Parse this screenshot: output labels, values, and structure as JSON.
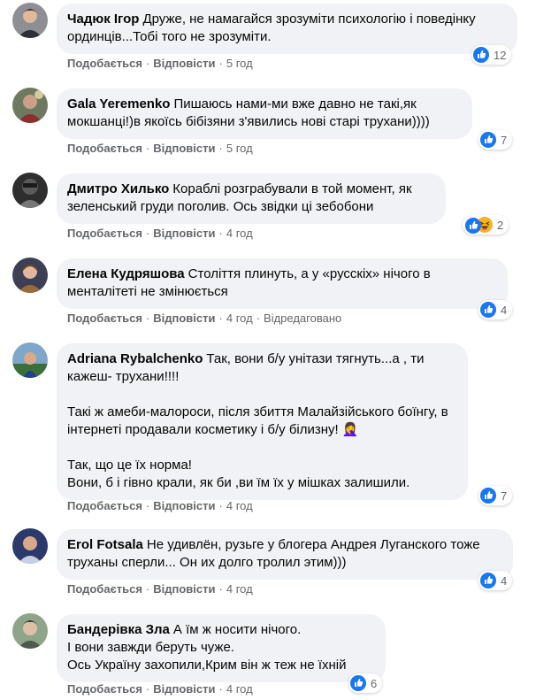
{
  "labels": {
    "like": "Подобається",
    "reply": "Відповісти",
    "dot": "·"
  },
  "colors": {
    "bubble": "#f0f2f5",
    "like_blue": "#1877f2",
    "haha_yellow": "#f7b125",
    "meta_gray": "#65676b"
  },
  "comments": [
    {
      "author": "Чадюк Ігор",
      "text": "Друже, не намагайся зрозуміти психологію і поведінку ординців...Тобі того не зрозуміти.",
      "time": "5 год",
      "reaction_count": "12",
      "reaction_icons": [
        "like-icon"
      ]
    },
    {
      "author": "Gala Yeremenko",
      "text": "Пишаюсь нами-ми вже давно не такі,як мокшанці!)в якоїсь бібізяни з'явились нові старі трухани))))",
      "time": "5 год",
      "reaction_count": "7",
      "reaction_icons": [
        "like-icon"
      ]
    },
    {
      "author": "Дмитро Хилько",
      "text": "Кораблі розграбували в той момент, як зеленський груди поголив. Ось звідки ці зебобони",
      "time": "4 год",
      "reaction_count": "2",
      "reaction_icons": [
        "like-icon",
        "haha-icon"
      ]
    },
    {
      "author": "Елена Кудряшова",
      "text": "Століття плинуть, а у «русскіх» нічого в менталітеті не змінюється",
      "time": "4 год",
      "edited": "Відредаговано",
      "reaction_count": "4",
      "reaction_icons": [
        "like-icon"
      ]
    },
    {
      "author": "Adriana Rybalchenko",
      "text": "Так, вони б/у унітази тягнуть...а , ти кажеш- трухани!!!!",
      "text2": "Такі ж амеби-малороси, після збиття Малайзійського боїнгу, в інтернеті продавали косметику і б/у білизну! 🤦‍♀️",
      "text3": "Так, що це їх норма!",
      "text4": "Вони, б і гівно крали, як би ,ви їм їх у мішках залишили.",
      "time": "4 год",
      "reaction_count": "7",
      "reaction_icons": [
        "like-icon"
      ]
    },
    {
      "author": "Erol Fotsala",
      "text": "Не удивлён, рузьге у блогера Андрея Луганского тоже труханы сперли... Он их долго тролил этим)))",
      "time": "4 год",
      "reaction_count": "4",
      "reaction_icons": [
        "like-icon"
      ]
    },
    {
      "author": "Бандерівка Зла",
      "text": "А їм ж носити нічого.",
      "text2": "І вони завжди беруть чуже.",
      "text3": "Ось Україну захопили,Крим він ж теж не їхній",
      "time": "4 год",
      "reaction_count": "6",
      "reaction_icons": [
        "like-icon"
      ]
    }
  ]
}
